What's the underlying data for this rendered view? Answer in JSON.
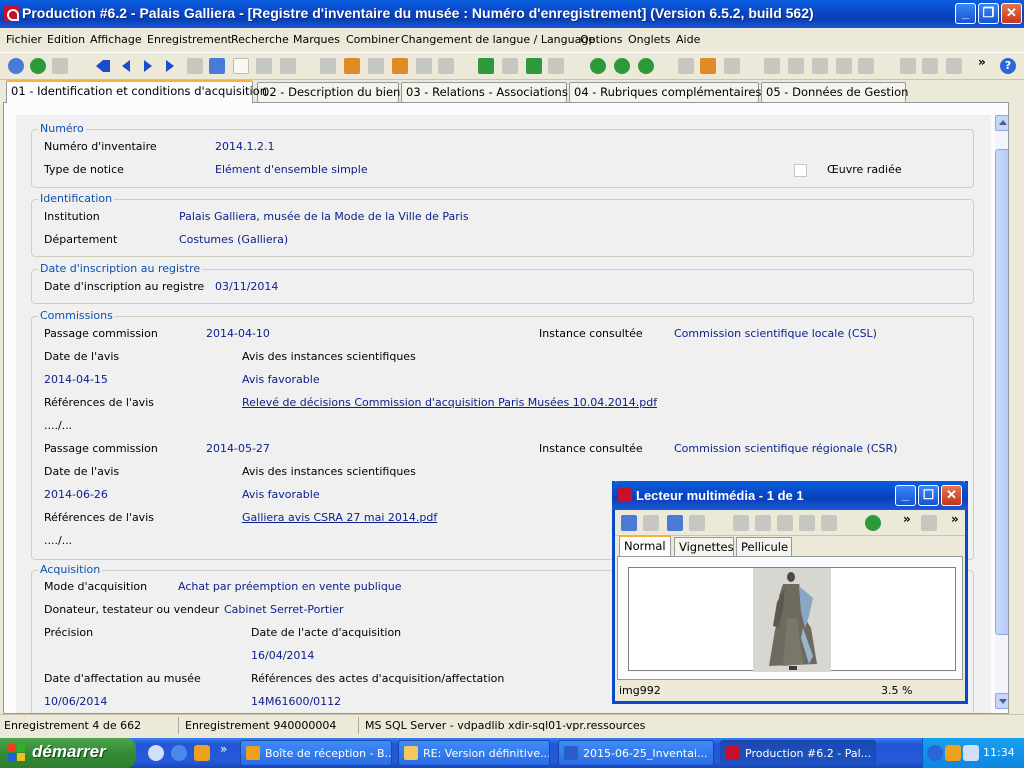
{
  "window": {
    "title": "Production #6.2 - Palais Galliera - [Registre d'inventaire du musée : Numéro d'enregistrement] (Version 6.5.2, build 562)"
  },
  "menu": [
    "Fichier",
    "Edition",
    "Affichage",
    "Enregistrement",
    "Recherche",
    "Marques",
    "Combiner",
    "Changement de langue / Language",
    "Options",
    "Onglets",
    "Aide"
  ],
  "tabs": [
    {
      "label": "01 - Identification et conditions d'acquisition",
      "active": true
    },
    {
      "label": "02 -  Description du bien"
    },
    {
      "label": "03 - Relations - Associations"
    },
    {
      "label": "04 - Rubriques complémentaires"
    },
    {
      "label": "05 - Données de Gestion"
    }
  ],
  "form": {
    "numero": {
      "legend": "Numéro",
      "inv_label": "Numéro d'inventaire",
      "inv_value": "2014.1.2.1",
      "type_label": "Type de notice",
      "type_value": "Elément d'ensemble simple",
      "radiee_label": "Œuvre radiée"
    },
    "identification": {
      "legend": "Identification",
      "institution_label": "Institution",
      "institution_value": "Palais Galliera, musée de la Mode de la Ville de Paris",
      "departement_label": "Département",
      "departement_value": "Costumes (Galliera)"
    },
    "inscription": {
      "legend": "Date d'inscription au registre",
      "date_label": "Date d'inscription au registre",
      "date_value": "03/11/2014"
    },
    "commissions": {
      "legend": "Commissions",
      "entries": [
        {
          "passage_label": "Passage commission",
          "passage_value": "2014-04-10",
          "instance_label": "Instance consultée",
          "instance_value": "Commission scientifique locale (CSL)",
          "date_avis_label": "Date de l'avis",
          "avis_label": "Avis des instances scientifiques",
          "date_avis_value": "2014-04-15",
          "avis_value": "Avis favorable",
          "refs_label": "Références de l'avis",
          "refs_value": "Relevé de décisions Commission d'acquisition Paris Musées 10.04.2014.pdf",
          "more": "..../..."
        },
        {
          "passage_label": "Passage commission",
          "passage_value": "2014-05-27",
          "instance_label": "Instance consultée",
          "instance_value": "Commission scientifique régionale (CSR)",
          "date_avis_label": "Date de l'avis",
          "avis_label": "Avis des instances scientifiques",
          "date_avis_value": "2014-06-26",
          "avis_value": "Avis favorable",
          "refs_label": "Références de l'avis",
          "refs_value": "Galliera avis CSRA 27 mai 2014.pdf",
          "more": "..../..."
        }
      ]
    },
    "acquisition": {
      "legend": "Acquisition",
      "mode_label": "Mode d'acquisition",
      "mode_value": "Achat par préemption en vente publique",
      "donateur_label": "Donateur, testateur ou vendeur",
      "donateur_value": "Cabinet Serret-Portier",
      "precision_label": "Précision",
      "date_acte_label": "Date de l'acte d'acquisition",
      "date_acte_value": "16/04/2014",
      "date_affect_label": "Date d'affectation au musée",
      "date_affect_value": "10/06/2014",
      "refs_actes_label": "Références des actes d'acquisition/affectation",
      "refs_actes_value": "14M61600/0112"
    }
  },
  "statusbar": {
    "record": "Enregistrement 4 de 662",
    "record_id": "Enregistrement 940000004",
    "server": "MS SQL Server - vdpadlib xdir-sql01-vpr.ressources"
  },
  "multimedia": {
    "title": "Lecteur multimédia - 1 de 1",
    "tabs": [
      "Normal",
      "Vignettes",
      "Pellicule"
    ],
    "filename": "img992",
    "zoom": "3.5 %"
  },
  "taskbar": {
    "start": "démarrer",
    "tasks": [
      {
        "label": "Boîte de réception - B...",
        "color": "#f0a020"
      },
      {
        "label": "RE: Version définitive...",
        "color": "#f8c860"
      },
      {
        "label": "2015-06-25_Inventai...",
        "color": "#2a5cc8"
      },
      {
        "label": "Production #6.2 - Pal...",
        "color": "#c8102e",
        "active": true
      }
    ],
    "time": "11:34"
  },
  "icons": {
    "title": "app-icon",
    "accent": "#0a1e8c",
    "legend_color": "#0c4fb0"
  }
}
